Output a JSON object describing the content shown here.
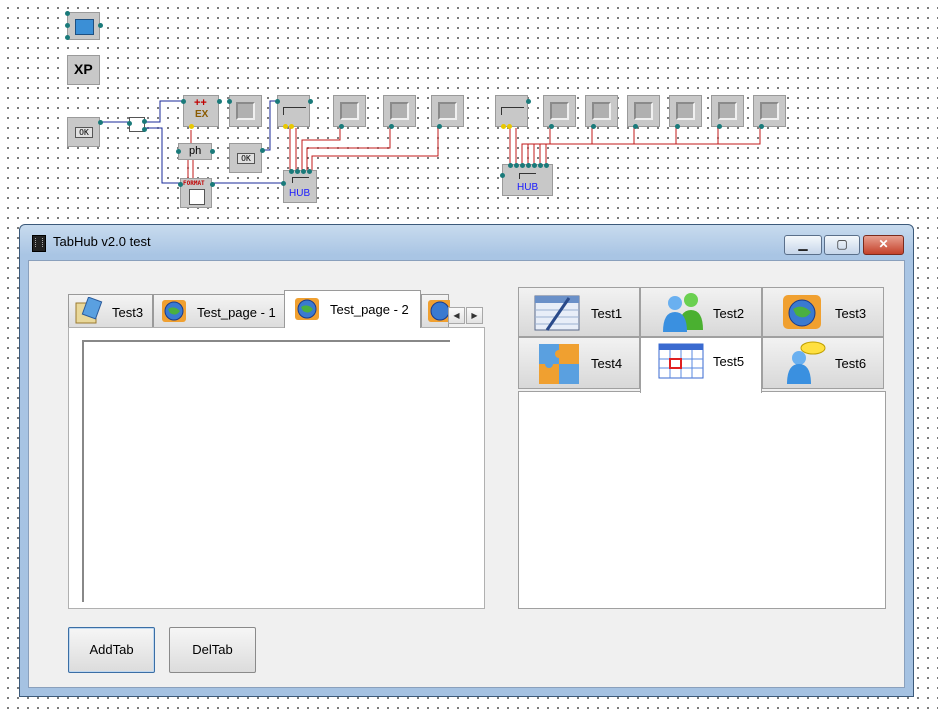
{
  "canvas": {
    "xp_label": "XP",
    "ok_label": "OK",
    "ex_label": "EX",
    "ex_plus": "++",
    "ph_label": "ph",
    "format_label": "FORMAT",
    "hub_label": "HUB",
    "wire_blue": "#1a2a9a",
    "wire_red": "#c01818"
  },
  "window": {
    "title": "TabHub v2.0 test",
    "minimize_glyph": "▁",
    "maximize_glyph": "▢",
    "close_glyph": "✕"
  },
  "left_tabs": {
    "tabs": [
      {
        "label": "Test3",
        "icon": "notepad-icon"
      },
      {
        "label": "Test_page - 1",
        "icon": "globe-puzzle-icon"
      },
      {
        "label": "Test_page - 2",
        "icon": "globe-puzzle-icon",
        "active": true
      },
      {
        "label": "",
        "icon": "globe-puzzle-icon"
      }
    ],
    "scroll_left": "◀",
    "scroll_right": "▶"
  },
  "right_tabs": {
    "tabs": [
      {
        "label": "Test1",
        "icon": "spreadsheet-pen-icon"
      },
      {
        "label": "Test2",
        "icon": "users-icon"
      },
      {
        "label": "Test3",
        "icon": "globe-puzzle-icon"
      },
      {
        "label": "Test4",
        "icon": "puzzle-icon"
      },
      {
        "label": "Test5",
        "icon": "calendar-grid-icon",
        "active": true
      },
      {
        "label": "Test6",
        "icon": "user-chat-icon"
      }
    ]
  },
  "buttons": {
    "add_tab": "AddTab",
    "del_tab": "DelTab"
  }
}
